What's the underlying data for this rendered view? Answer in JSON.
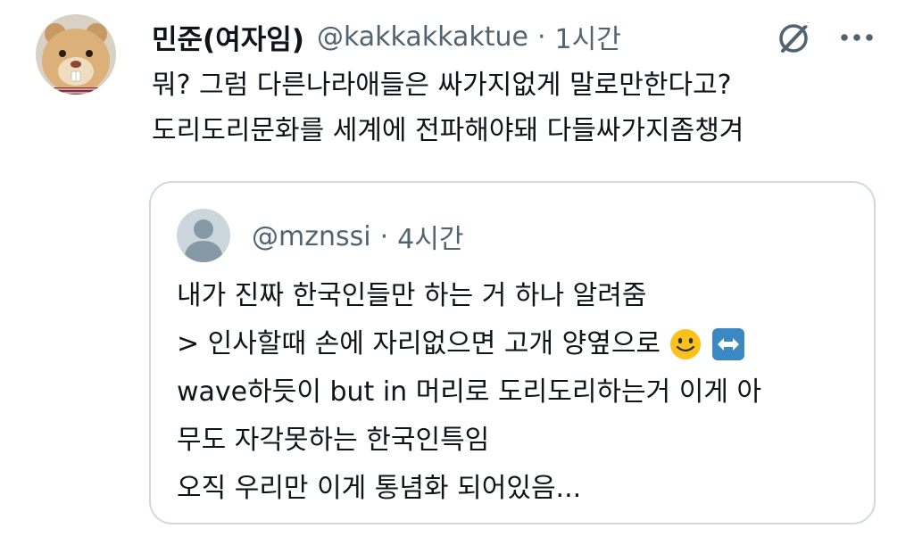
{
  "author": {
    "display_name": "민준(여자임)",
    "handle": "@kakkakkaktue",
    "separator": "·",
    "time": "1시간",
    "avatar_icon": "hamster-plush-avatar"
  },
  "actions": {
    "grok_icon": "grok-icon",
    "more_icon": "more-icon"
  },
  "post": {
    "lines": [
      "뭐? 그럼 다른나라애들은 싸가지없게 말로만한다고?",
      "도리도리문화를 세계에 전파해야돼 다들싸가지좀챙겨"
    ]
  },
  "quote": {
    "handle": "@mznssi",
    "separator": "·",
    "time": "4시간",
    "avatar_icon": "default-avatar-icon",
    "lines": [
      "내가 진짜 한국인들만 하는 거 하나 알려줌",
      "> 인사할때 손에 자리없으면 고개 양옆으로",
      "wave하듯이 but in 머리로 도리도리하는거 이게 아",
      "무도 자각못하는 한국인특임",
      "오직 우리만 이게 통념화 되어있음..."
    ],
    "emojis": [
      "slightly-smiling-face",
      "left-right-arrow"
    ]
  },
  "colors": {
    "text_primary": "#0f1419",
    "text_secondary": "#536471",
    "card_border": "#cfd9de"
  }
}
